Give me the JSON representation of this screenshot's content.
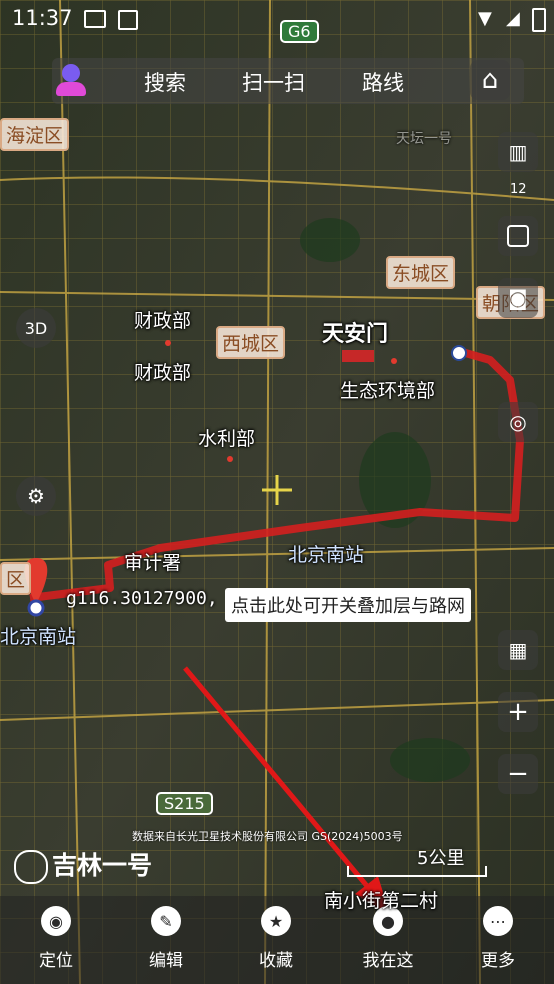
{
  "status_bar": {
    "time": "11:37"
  },
  "top_bar": {
    "search_label": "搜索",
    "scan_label": "扫一扫",
    "route_label": "路线"
  },
  "side_controls": {
    "layers_count": "12",
    "zoom_in": "+",
    "zoom_out": "−"
  },
  "map": {
    "districts": [
      "海淀区",
      "东城区",
      "西城区",
      "朝阳区",
      "区"
    ],
    "pois": [
      "天安门",
      "财政部",
      "财政部",
      "水利部",
      "生态环境部",
      "北京南站",
      "审计署",
      "北京南站",
      "南小街第二村"
    ],
    "road_shields": [
      "G6",
      "S215"
    ],
    "watermark_text": "天坛一号"
  },
  "coordinate_text": "g116.30127900,",
  "tooltip_text": "点击此处可开关叠加层与路网",
  "brand_name": "吉林一号",
  "copyright_text": "数据来自长光卫星技术股份有限公司 GS(2024)5003号",
  "scale_label": "5公里",
  "bottom_nav": [
    {
      "label": "定位"
    },
    {
      "label": "编辑"
    },
    {
      "label": "收藏"
    },
    {
      "label": "我在这"
    },
    {
      "label": "更多"
    }
  ],
  "colors": {
    "route": "#d41f1f",
    "arrow": "#e01818",
    "district_text": "#8a4d24",
    "marker": "#e23a2e"
  }
}
